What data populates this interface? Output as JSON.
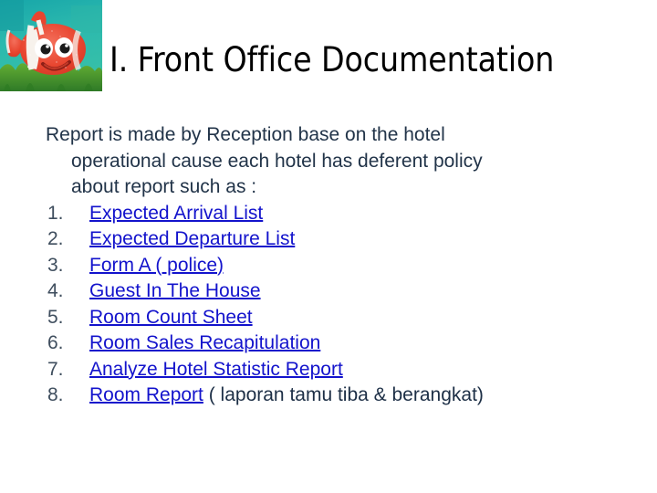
{
  "slide": {
    "title": "I. Front Office Documentation",
    "image": {
      "name": "clownfish-illustration",
      "alt": "Cartoon clownfish swimming over green coral in teal water",
      "colors": {
        "water_top": "#1fa7a8",
        "water_mid": "#27b3ad",
        "coral_green": "#4f9b2f",
        "fish_orange": "#e8452f",
        "fish_highlight": "#f2705a",
        "fish_white": "#f7f2ee",
        "fish_black": "#1b1b1b"
      }
    },
    "intro": {
      "line1": "Report is made by Reception base on the hotel",
      "line2": "operational cause each hotel has deferent policy",
      "line3": "about report such as :"
    },
    "list": [
      {
        "number": "1.",
        "link": "Expected Arrival List",
        "trailing": ""
      },
      {
        "number": "2.",
        "link": "Expected Departure List",
        "trailing": ""
      },
      {
        "number": "3.",
        "link": "Form A ( police)",
        "trailing": ""
      },
      {
        "number": "4.",
        "link": "Guest In The House",
        "trailing": ""
      },
      {
        "number": "5.",
        "link": "Room Count Sheet",
        "trailing": ""
      },
      {
        "number": "6.",
        "link": "Room Sales Recapitulation",
        "trailing": ""
      },
      {
        "number": "7.",
        "link": "Analyze Hotel Statistic Report",
        "trailing": ""
      },
      {
        "number": "8.",
        "link": "Room Report",
        "trailing": " ( laporan tamu tiba & berangkat)"
      }
    ],
    "colors": {
      "title": "#000000",
      "body_text": "#223449",
      "link": "#1313cc",
      "number": "#3f4e5e",
      "background": "#ffffff"
    }
  }
}
